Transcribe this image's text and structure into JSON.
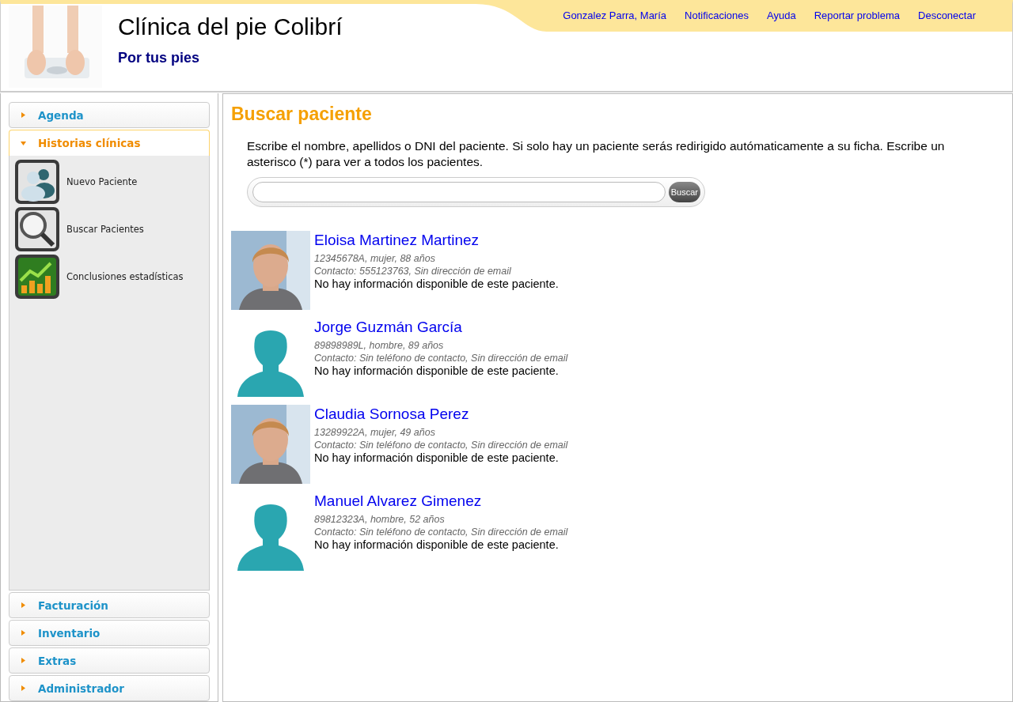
{
  "header": {
    "title": "Clínica del pie Colibrí",
    "subtitle": "Por tus pies",
    "links": [
      "Gonzalez Parra, María",
      "Notificaciones",
      "Ayuda",
      "Reportar problema",
      "Desconectar"
    ]
  },
  "sidebar": {
    "sections": [
      {
        "label": "Agenda",
        "expanded": false
      },
      {
        "label": "Historias clínicas",
        "expanded": true,
        "items": [
          {
            "label": "Nuevo Paciente",
            "kind": "users"
          },
          {
            "label": "Buscar Pacientes",
            "kind": "search"
          },
          {
            "label": "Conclusiones estadísticas",
            "kind": "chart"
          }
        ]
      },
      {
        "label": "Facturación",
        "expanded": false
      },
      {
        "label": "Inventario",
        "expanded": false
      },
      {
        "label": "Extras",
        "expanded": false
      },
      {
        "label": "Administrador",
        "expanded": false
      }
    ]
  },
  "main": {
    "title": "Buscar paciente",
    "instructions": "Escribe el nombre, apellidos o DNI del paciente. Si solo hay un paciente serás redirigido autómaticamente a su ficha. Escribe un asterisco (*) para ver a todos los pacientes.",
    "search_button": "Buscar",
    "patients": [
      {
        "name": "Eloisa Martinez Martinez",
        "kind": "picture",
        "details": "12345678A, mujer, 88 años",
        "contact": "Contacto: 555123763, Sin dirección de email",
        "info": "No hay información disponible de este paciente."
      },
      {
        "name": "Jorge Guzmán García",
        "kind": "silhouette",
        "details": "89898989L, hombre, 89 años",
        "contact": "Contacto: Sin teléfono de contacto, Sin dirección de email",
        "info": "No hay información disponible de este paciente."
      },
      {
        "name": "Claudia Sornosa Perez",
        "kind": "picture",
        "details": "13289922A, mujer, 49 años",
        "contact": "Contacto: Sin teléfono de contacto, Sin dirección de email",
        "info": "No hay información disponible de este paciente."
      },
      {
        "name": "Manuel Alvarez Gimenez",
        "kind": "silhouette",
        "details": "89812323A, hombre, 52 años",
        "contact": "Contacto: Sin teléfono de contacto, Sin dirección de email",
        "info": "No hay información disponible de este paciente."
      }
    ]
  }
}
